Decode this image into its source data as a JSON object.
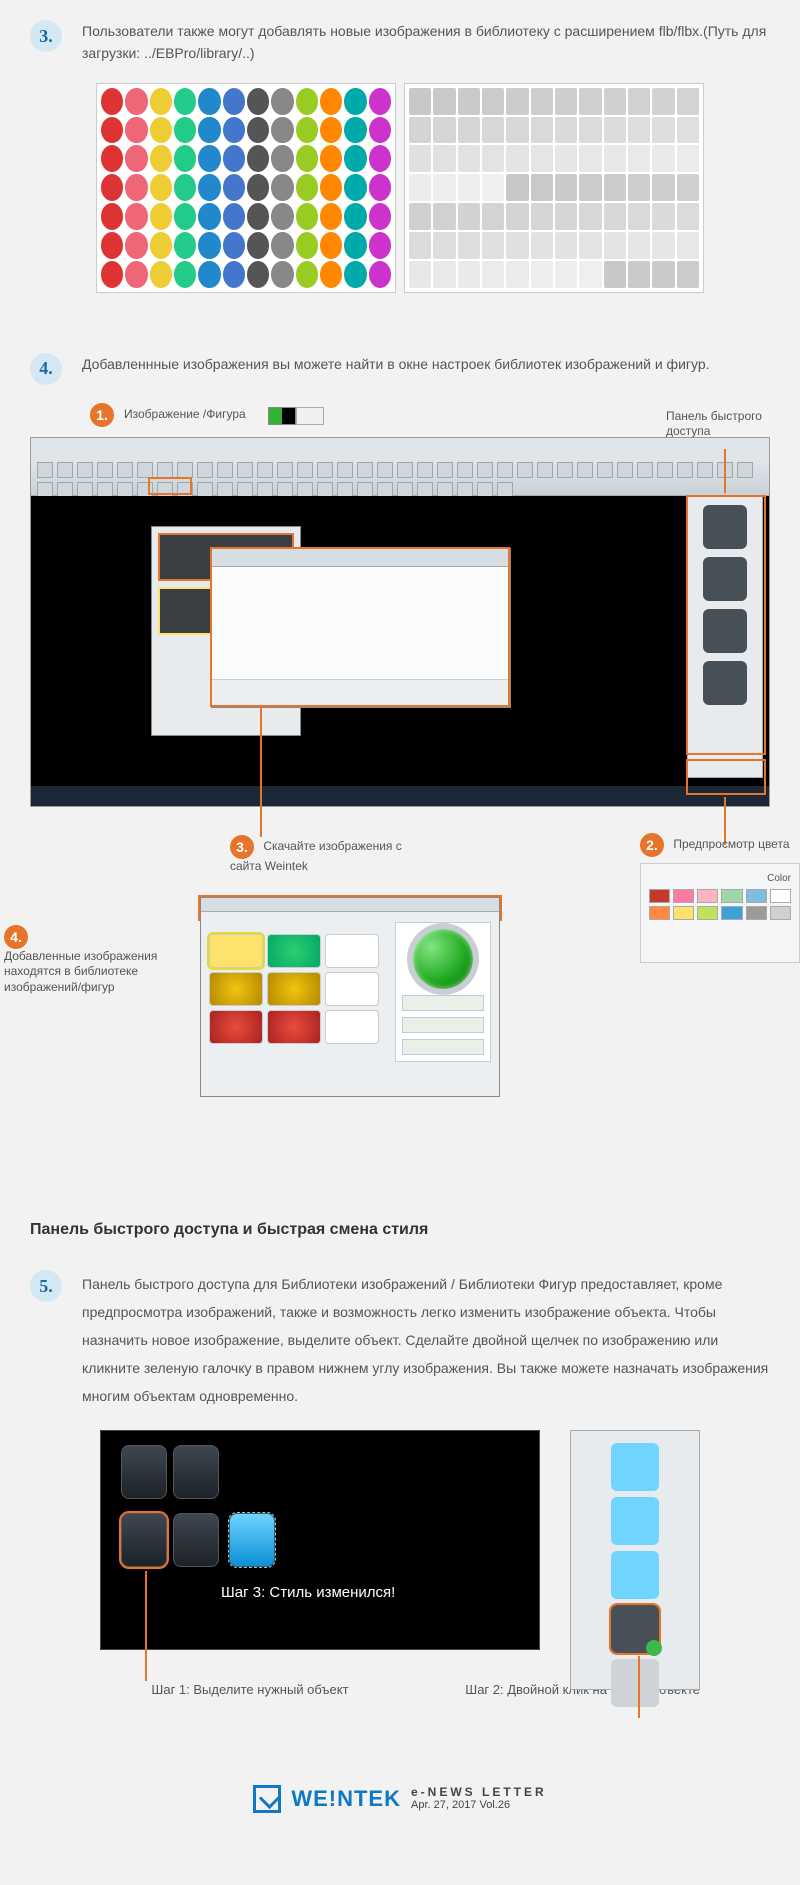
{
  "step3": {
    "num": "3.",
    "text": "Пользователи также могут добавлять новые изображения в библиотеку с расширением flb/flbx.(Путь для загрузки: ../EBPro/library/..)"
  },
  "step4": {
    "num": "4.",
    "text": "Добавленнные изображения вы можете найти в окне настроек библиотек изображений и фигур."
  },
  "anno": {
    "a1_num": "1.",
    "a1_label": "Изображение /Фигура",
    "panel_label": "Панель быстрого доступа",
    "a3_num": "3.",
    "a3_label": "Скачайте изображения с сайта Weintek",
    "a2_num": "2.",
    "a2_label": "Предпросмотр цвета",
    "a4_num": "4.",
    "a4_label": "Добавленные изображения находятся в библиотеке изображений/фигур",
    "color_label": "Color"
  },
  "subheading": "Панель быстрого доступа и быстрая смена стиля",
  "step5": {
    "num": "5.",
    "text": "Панель быстрого доступа для  Библиотеки изображений / Библиотеки Фигур предоставляет, кроме предпросмотра изображений, также и возможность легко изменить изображение объекта. Чтобы назначить новое изображение, выделите объект. Сделайте двойной щелчек по изображению или кликните зеленую галочку в правом нижнем углу изображения. Вы также можете назначать изображения многим объектам одновременно."
  },
  "style": {
    "step3_text": "Шаг 3: Стиль изменился!",
    "caption1": "Шаг 1: Выделите нужный объект",
    "caption2": "Шаг 2: Двойной клик на новом объекте"
  },
  "swatches": [
    "#c0392b",
    "#ff7aa2",
    "#ffb5c0",
    "#9fd7a8",
    "#7fbde0",
    "#ffffff",
    "#ff8a3d",
    "#ffe26b",
    "#bfe25a",
    "#3fa0d8",
    "#9b9b9b",
    "#d0d0d0"
  ],
  "footer": {
    "brand": "WE!NTEK",
    "line1": "e-NEWS  LETTER",
    "line2": "Apr. 27, 2017  Vol.26"
  }
}
